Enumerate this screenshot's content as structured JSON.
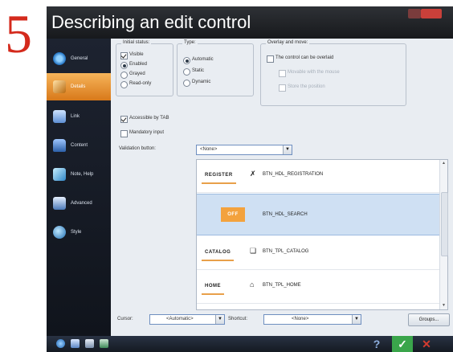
{
  "step_number": "5",
  "window": {
    "title": "Describing an edit control"
  },
  "sidebar": {
    "items": [
      {
        "label": "General",
        "icon": "clock-icon",
        "active": false
      },
      {
        "label": "Details",
        "icon": "edit-field-icon",
        "active": true
      },
      {
        "label": "Link",
        "icon": "link-file-icon",
        "active": false
      },
      {
        "label": "Content",
        "icon": "database-icon",
        "active": false
      },
      {
        "label": "Note, Help",
        "icon": "help-note-icon",
        "active": false
      },
      {
        "label": "Advanced",
        "icon": "advanced-icon",
        "active": false
      },
      {
        "label": "Style",
        "icon": "style-icon",
        "active": false
      }
    ]
  },
  "initial_status": {
    "title": "Initial status:",
    "visible": {
      "label": "Visible",
      "checked": true
    },
    "options": [
      {
        "label": "Enabled",
        "selected": true
      },
      {
        "label": "Grayed",
        "selected": false
      },
      {
        "label": "Read-only",
        "selected": false
      }
    ]
  },
  "type_group": {
    "title": "Type:",
    "options": [
      {
        "label": "Automatic",
        "selected": true
      },
      {
        "label": "Static",
        "selected": false
      },
      {
        "label": "Dynamic",
        "selected": false
      }
    ]
  },
  "overlay": {
    "title": "Overlay and move:",
    "main": {
      "label": "The control can be overlaid",
      "checked": false
    },
    "sub": [
      {
        "label": "Movable with the mouse",
        "checked": false
      },
      {
        "label": "Store the position",
        "checked": false
      }
    ]
  },
  "accessible_tab": {
    "label": "Accessible by TAB",
    "checked": true
  },
  "mandatory_input": {
    "label": "Mandatory input",
    "checked": false
  },
  "validation": {
    "label": "Validation button:",
    "value": "<None>"
  },
  "button_list": [
    {
      "badge": "REGISTER",
      "icon": "pencil-cross-icon",
      "name": "BTN_HDL_REGISTRATION",
      "selected": false
    },
    {
      "badge": "OFF",
      "icon": "",
      "name": "BTN_HDL_SEARCH",
      "selected": true
    },
    {
      "badge": "CATALOG",
      "icon": "book-icon",
      "name": "BTN_TPL_CATALOG",
      "selected": false
    },
    {
      "badge": "HOME",
      "icon": "home-icon",
      "name": "BTN_TPL_HOME",
      "selected": false
    }
  ],
  "bottom_bar": {
    "cursor_label": "Cursor:",
    "cursor_value": "<Automatic>",
    "shortcut_label": "Shortcut:",
    "shortcut_value": "<None>",
    "groups_button": "Groups..."
  },
  "taskbar": {
    "cancel_symbol": "✕",
    "ok_symbol": "✓",
    "help_symbol": "?"
  },
  "colors": {
    "accent_orange": "#f3a23d",
    "step_red": "#d42a1c",
    "ok_green": "#3aa54b",
    "cancel_red": "#d43b2f"
  }
}
